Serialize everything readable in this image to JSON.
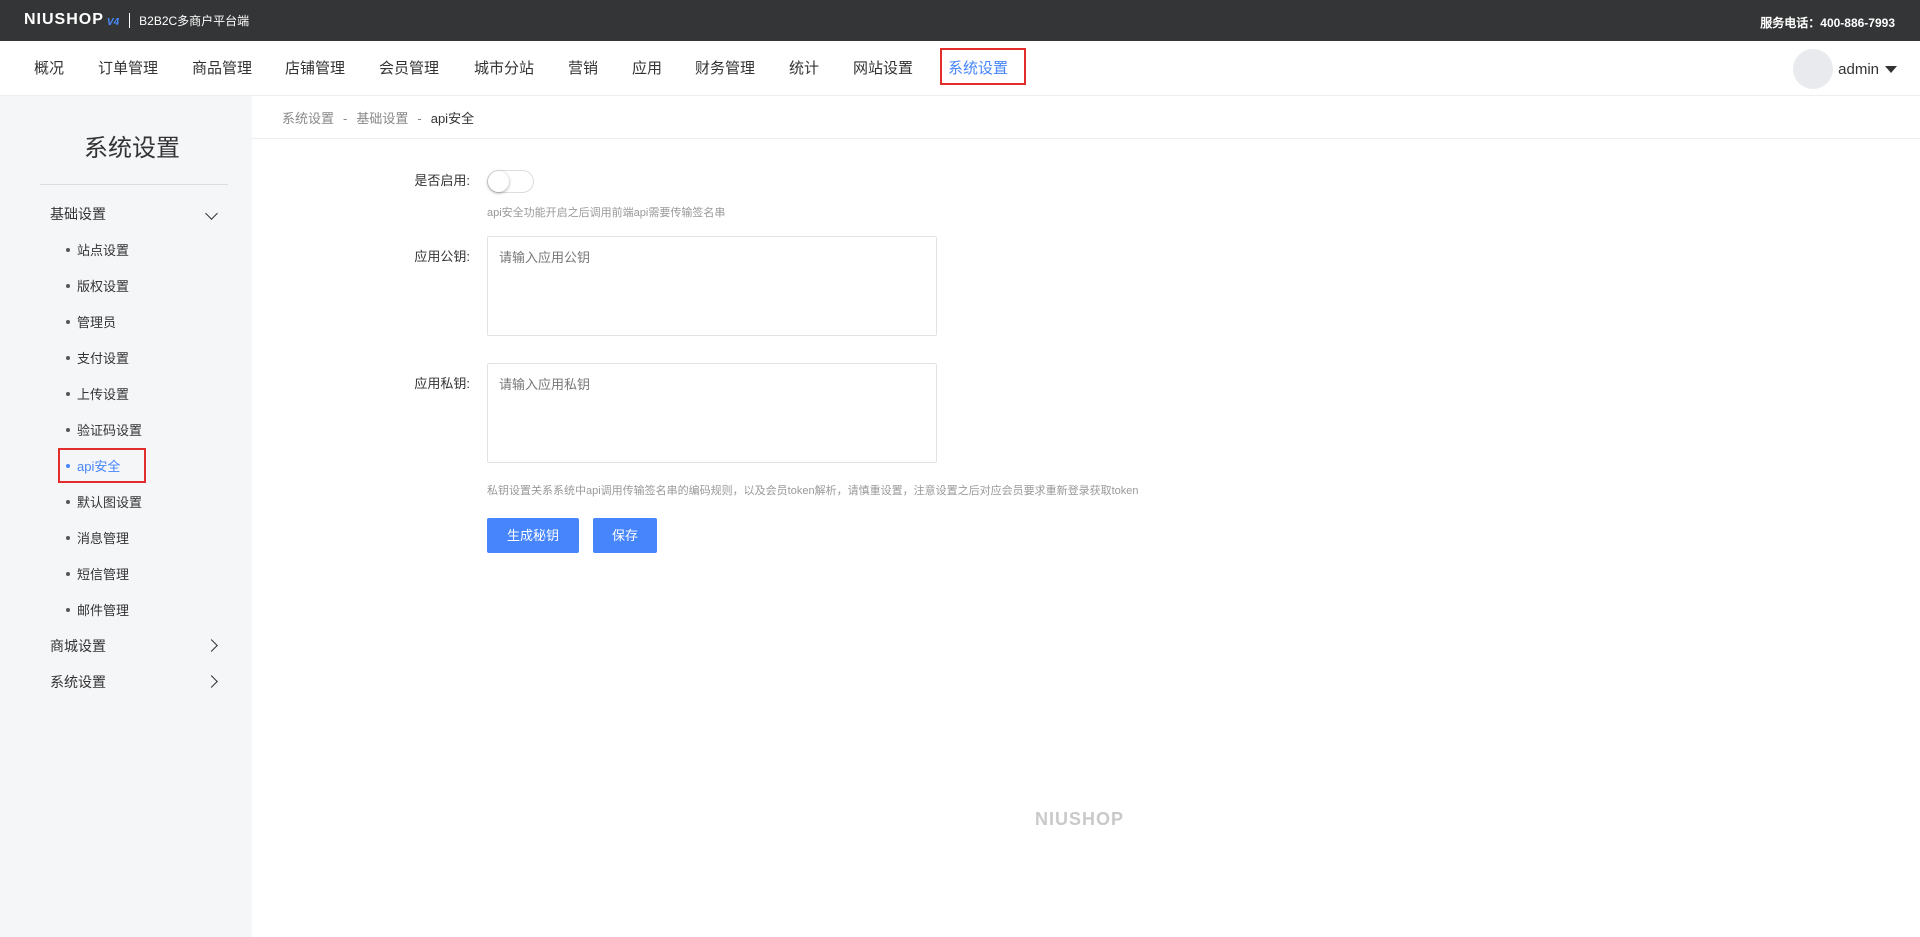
{
  "topbar": {
    "logo": "NIUSHOP",
    "logo_version": "V4",
    "subtitle": "B2B2C多商户平台端",
    "hotline": "服务电话：400-886-7993"
  },
  "nav": {
    "items": [
      {
        "label": "概况"
      },
      {
        "label": "订单管理"
      },
      {
        "label": "商品管理"
      },
      {
        "label": "店铺管理"
      },
      {
        "label": "会员管理"
      },
      {
        "label": "城市分站"
      },
      {
        "label": "营销"
      },
      {
        "label": "应用"
      },
      {
        "label": "财务管理"
      },
      {
        "label": "统计"
      },
      {
        "label": "网站设置"
      },
      {
        "label": "系统设置",
        "active": true
      }
    ],
    "user": "admin"
  },
  "sidebar": {
    "title": "系统设置",
    "groups": [
      {
        "label": "基础设置",
        "expanded": true
      },
      {
        "label": "商城设置",
        "expanded": false
      },
      {
        "label": "系统设置",
        "expanded": false
      }
    ],
    "items": [
      {
        "label": "站点设置"
      },
      {
        "label": "版权设置"
      },
      {
        "label": "管理员"
      },
      {
        "label": "支付设置"
      },
      {
        "label": "上传设置"
      },
      {
        "label": "验证码设置"
      },
      {
        "label": "api安全",
        "active": true
      },
      {
        "label": "默认图设置"
      },
      {
        "label": "消息管理"
      },
      {
        "label": "短信管理"
      },
      {
        "label": "邮件管理"
      }
    ]
  },
  "breadcrumb": {
    "items": [
      "系统设置",
      "基础设置",
      "api安全"
    ],
    "separator": "-"
  },
  "form": {
    "enable_label": "是否启用:",
    "enable_on": false,
    "enable_hint": "api安全功能开启之后调用前端api需要传输签名串",
    "public_key_label": "应用公钥:",
    "public_key_placeholder": "请输入应用公钥",
    "public_key_value": "",
    "private_key_label": "应用私钥:",
    "private_key_placeholder": "请输入应用私钥",
    "private_key_value": "",
    "private_key_hint": "私钥设置关系系统中api调用传输签名串的编码规则，以及会员token解析，请慎重设置，注意设置之后对应会员要求重新登录获取token",
    "generate_button": "生成秘钥",
    "save_button": "保存"
  },
  "footer": {
    "logo": "NIUSHOP"
  },
  "colors": {
    "accent": "#4685fb",
    "topbar": "#343536",
    "highlight": "#e32c2c"
  }
}
